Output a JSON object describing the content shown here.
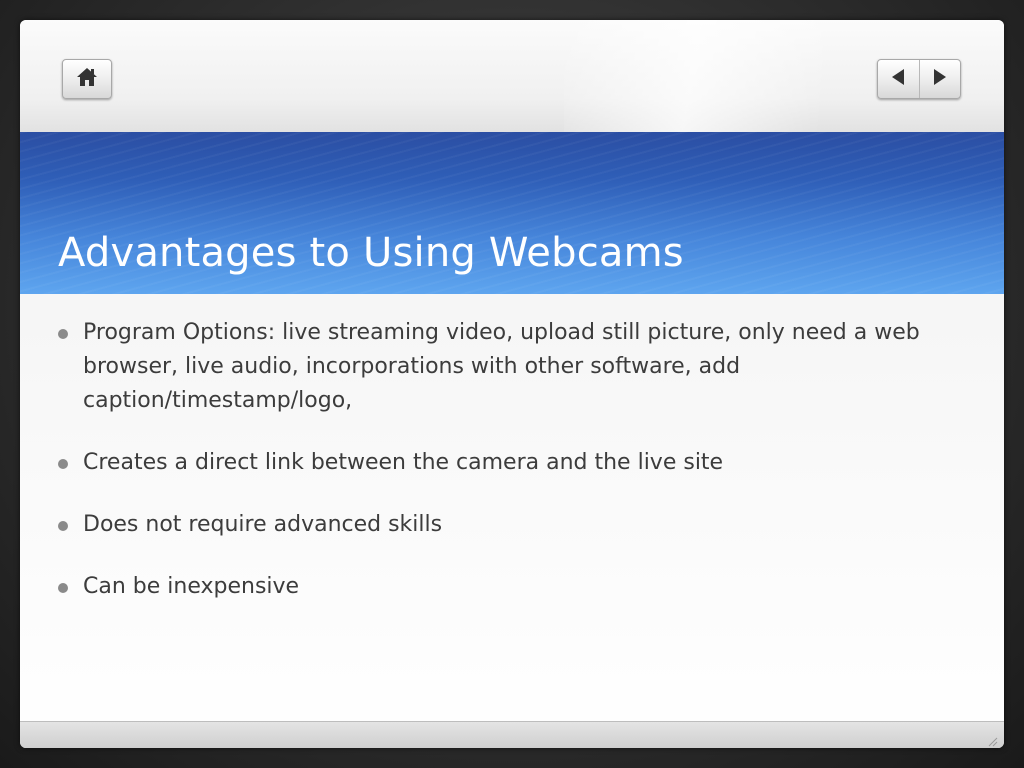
{
  "toolbar": {
    "home_icon": "home-icon",
    "prev_icon": "previous-slide-icon",
    "next_icon": "next-slide-icon"
  },
  "slide": {
    "title": "Advantages to Using Webcams",
    "bullets": [
      "Program Options: live streaming video, upload still picture, only need a web browser, live audio, incorporations with other software, add caption/timestamp/logo,",
      "Creates a direct link between the camera and the live site",
      "Does not require advanced skills",
      "Can be inexpensive"
    ]
  },
  "colors": {
    "title_band_top": "#2b4ea3",
    "title_band_bottom": "#5ea5ef",
    "title_text": "#ffffff",
    "body_text": "#3c3c3c",
    "bullet": "#8a8a8a"
  }
}
